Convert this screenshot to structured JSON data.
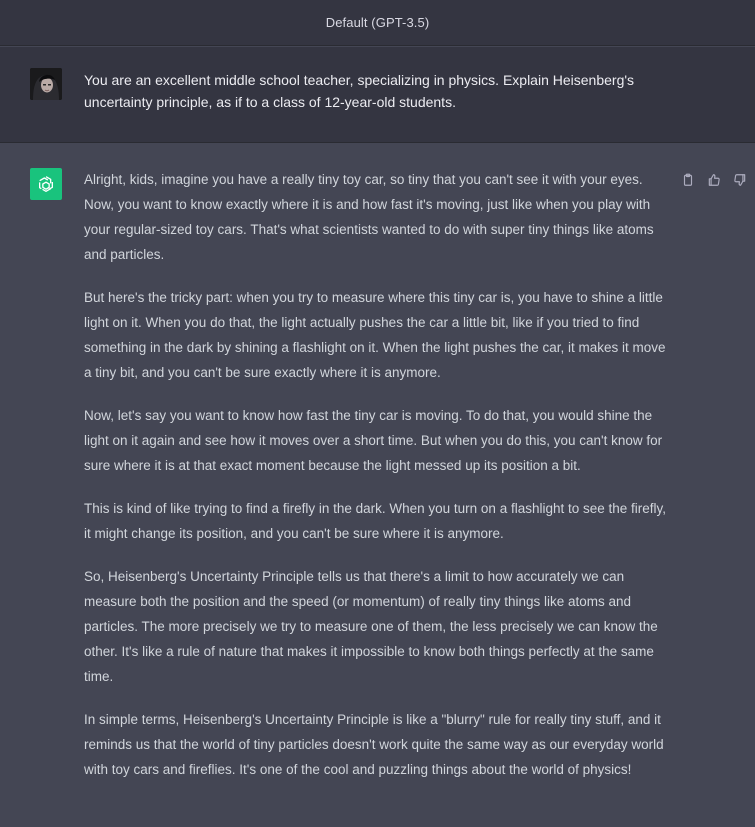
{
  "header": {
    "model_title": "Default (GPT-3.5)"
  },
  "user_message": {
    "text": "You are an excellent middle school teacher, specializing in physics. Explain Heisenberg's uncertainty principle, as if to a class of 12-year-old students."
  },
  "assistant_message": {
    "paragraphs": [
      "Alright, kids, imagine you have a really tiny toy car, so tiny that you can't see it with your eyes. Now, you want to know exactly where it is and how fast it's moving, just like when you play with your regular-sized toy cars. That's what scientists wanted to do with super tiny things like atoms and particles.",
      "But here's the tricky part: when you try to measure where this tiny car is, you have to shine a little light on it. When you do that, the light actually pushes the car a little bit, like if you tried to find something in the dark by shining a flashlight on it. When the light pushes the car, it makes it move a tiny bit, and you can't be sure exactly where it is anymore.",
      "Now, let's say you want to know how fast the tiny car is moving. To do that, you would shine the light on it again and see how it moves over a short time. But when you do this, you can't know for sure where it is at that exact moment because the light messed up its position a bit.",
      "This is kind of like trying to find a firefly in the dark. When you turn on a flashlight to see the firefly, it might change its position, and you can't be sure where it is anymore.",
      "So, Heisenberg's Uncertainty Principle tells us that there's a limit to how accurately we can measure both the position and the speed (or momentum) of really tiny things like atoms and particles. The more precisely we try to measure one of them, the less precisely we can know the other. It's like a rule of nature that makes it impossible to know both things perfectly at the same time.",
      "In simple terms, Heisenberg's Uncertainty Principle is like a \"blurry\" rule for really tiny stuff, and it reminds us that the world of tiny particles doesn't work quite the same way as our everyday world with toy cars and fireflies. It's one of the cool and puzzling things about the world of physics!"
    ]
  },
  "icons": {
    "user_avatar": "user-avatar-photo",
    "assistant_avatar": "openai-logo-icon",
    "copy": "clipboard-icon",
    "like": "thumbs-up-icon",
    "dislike": "thumbs-down-icon"
  },
  "colors": {
    "header_bg": "#343541",
    "user_row_bg": "#343541",
    "assistant_row_bg": "#444654",
    "assistant_avatar_bg": "#19c37d"
  }
}
